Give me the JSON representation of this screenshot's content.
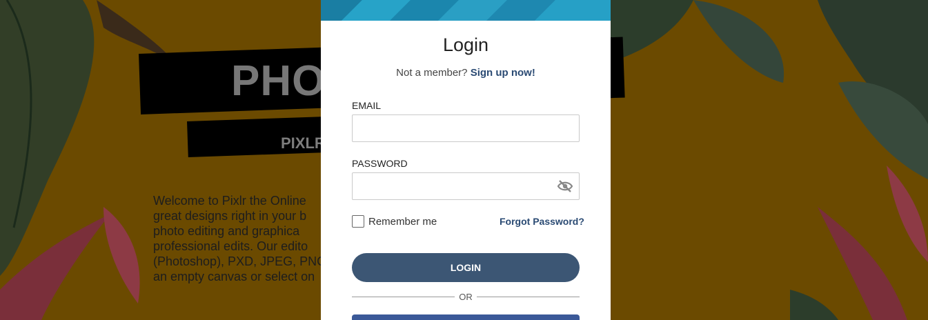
{
  "background": {
    "hero_title": "PHOT",
    "hero_subtitle": "PIXLR",
    "welcome_lines": [
      "Welcome to Pixlr the Online",
      "great designs right in your b",
      "photo editing and graphica",
      "professional edits. Our edito",
      "(Photoshop), PXD, JPEG, PNG",
      "an empty canvas or select on"
    ]
  },
  "login": {
    "title": "Login",
    "member_prompt": "Not a member?",
    "signup_link": "Sign up now!",
    "email_label": "EMAIL",
    "email_value": "",
    "password_label": "PASSWORD",
    "password_value": "",
    "remember_label": "Remember me",
    "forgot_link": "Forgot Password?",
    "login_button": "LOGIN",
    "or_text": "OR"
  },
  "colors": {
    "accent": "#3c5674",
    "link": "#2a4a73",
    "header": "#1f90b7",
    "background": "#6b4a00"
  },
  "icons": {
    "password_toggle": "eye-slash-icon"
  }
}
